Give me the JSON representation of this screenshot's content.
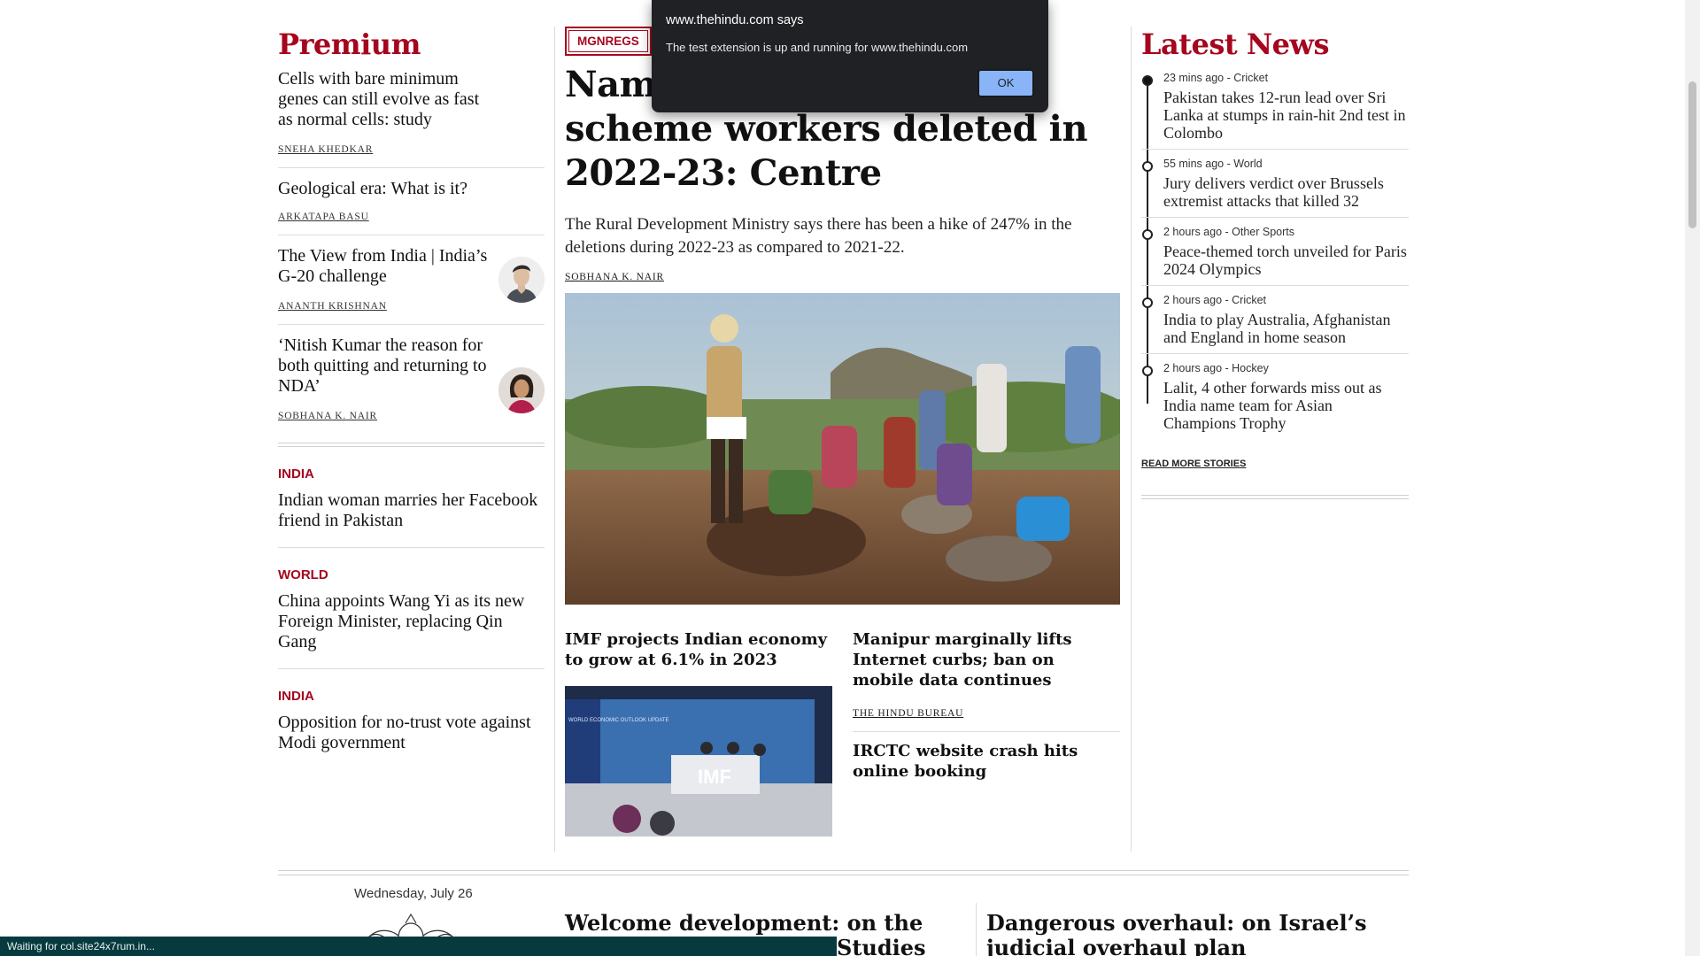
{
  "premium": {
    "heading": "Premium",
    "items": [
      {
        "title": "Cells with bare minimum genes can still evolve as fast as normal cells: study",
        "author": "SNEHA KHEDKAR"
      },
      {
        "title": "Geological era: What is it?",
        "author": "ARKATAPA BASU"
      },
      {
        "title": "The View from India | India’s G-20 challenge",
        "author": "ANANTH KRISHNAN"
      },
      {
        "title": "‘Nitish Kumar the reason for both quitting and returning to NDA’",
        "author": "SOBHANA K. NAIR"
      }
    ]
  },
  "category_stories": [
    {
      "category": "INDIA",
      "title": "Indian woman marries her Facebook friend in Pakistan"
    },
    {
      "category": "WORLD",
      "title": "China appoints Wang Yi as its new Foreign Minister, replacing Qin Gang"
    },
    {
      "category": "INDIA",
      "title": "Opposition for no-trust vote against Modi government"
    }
  ],
  "lead": {
    "tag": "MGNREGS",
    "title_visible": "Nam",
    "title_rest": "scheme workers deleted in 2022-23: Centre",
    "dek": "The Rural Development Ministry says there has been a hike of 247% in the deletions during 2022-23 as compared to 2021-22.",
    "author": "SOBHANA K. NAIR"
  },
  "sub_stories": {
    "left": {
      "title": "IMF projects Indian economy to grow at 6.1% in 2023",
      "image_text": "IMF",
      "image_caption": "WORLD ECONOMIC OUTLOOK UPDATE"
    },
    "right": {
      "title": "Manipur marginally lifts Internet curbs; ban on mobile data continues",
      "author": "THE HINDU BUREAU"
    },
    "right2": {
      "title": "IRCTC website crash hits online booking"
    }
  },
  "latest_news": {
    "heading": "Latest News",
    "items": [
      {
        "time": "23 mins ago",
        "category": "Cricket",
        "title": "Pakistan takes 12-run lead over Sri Lanka at stumps in rain-hit 2nd test in Colombo"
      },
      {
        "time": "55 mins ago",
        "category": "World",
        "title": "Jury delivers verdict over Brussels extremist attacks that killed 32"
      },
      {
        "time": "2 hours ago",
        "category": "Other Sports",
        "title": "Peace-themed torch unveiled for Paris 2024 Olympics"
      },
      {
        "time": "2 hours ago",
        "category": "Cricket",
        "title": "India to play Australia, Afghanistan and England in home season"
      },
      {
        "time": "2 hours ago",
        "category": "Hockey",
        "title": "Lalit, 4 other forwards miss out as India name team for Asian Champions Trophy"
      }
    ],
    "read_more": "READ MORE STORIES"
  },
  "bottom": {
    "date": "Wednesday, July 26",
    "editorial_1": "Welcome development: on the ICMR and",
    "editorial_1_line2": "Studies",
    "editorial_2": "Dangerous overhaul: on Israel’s judicial overhaul plan"
  },
  "status_bar": {
    "text": "Waiting for col.site24x7rum.in..."
  },
  "alert": {
    "title": "www.thehindu.com says",
    "message": "The test extension is up and running for www.thehindu.com",
    "ok_label": "OK"
  },
  "colors": {
    "accent_red": "#a5061e",
    "dialog_bg": "#202124",
    "ok_button": "#8ab4f8",
    "status_bar_bg": "#063a3e"
  }
}
